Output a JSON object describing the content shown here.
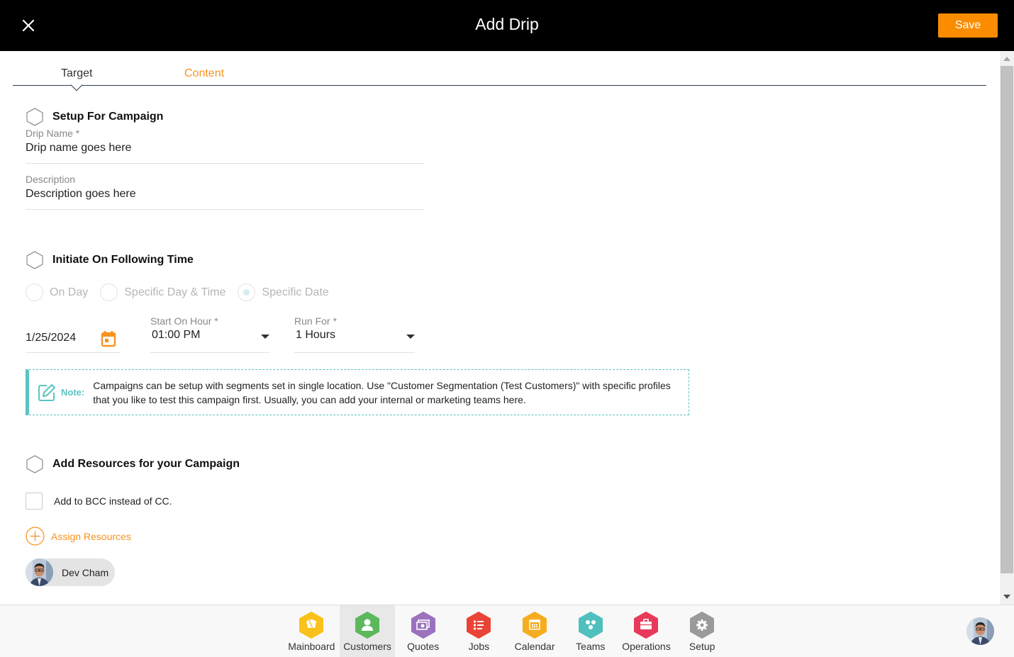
{
  "header": {
    "title": "Add Drip",
    "save_label": "Save",
    "close_icon": "close-icon"
  },
  "tabs": [
    {
      "label": "Target",
      "active": true
    },
    {
      "label": "Content",
      "active": false
    }
  ],
  "sections": {
    "setup": {
      "title": "Setup For Campaign",
      "drip_name": {
        "label": "Drip Name *",
        "value": "Drip name goes here"
      },
      "description": {
        "label": "Description",
        "value": "Description goes here"
      }
    },
    "initiate": {
      "title": "Initiate On Following Time",
      "radios": [
        {
          "label": "On Day",
          "checked": false
        },
        {
          "label": "Specific Day & Time",
          "checked": false
        },
        {
          "label": "Specific Date",
          "checked": true
        }
      ],
      "date": {
        "value": "1/25/2024",
        "icon": "calendar-icon"
      },
      "start_on_hour": {
        "label": "Start On Hour *",
        "value": "01:00 PM"
      },
      "run_for": {
        "label": "Run For *",
        "value": "1 Hours"
      },
      "note": {
        "label": "Note:",
        "text": "Campaigns can be setup with segments set in single location. Use \"Customer Segmentation (Test Customers)\" with specific profiles that you like to test this campaign first. Usually, you can add your internal or marketing teams here."
      }
    },
    "resources": {
      "title": "Add Resources for your Campaign",
      "bcc_checkbox": {
        "label": "Add to BCC instead of CC.",
        "checked": false
      },
      "assign_label": "Assign Resources",
      "assigned": [
        {
          "name": "Dev Cham"
        }
      ]
    }
  },
  "bottom_nav": {
    "items": [
      {
        "label": "Mainboard",
        "color": "#f9c21a",
        "icon": "mainboard-icon",
        "active": false
      },
      {
        "label": "Customers",
        "color": "#5cb85c",
        "icon": "customers-icon",
        "active": true
      },
      {
        "label": "Quotes",
        "color": "#9b72bd",
        "icon": "quotes-icon",
        "active": false
      },
      {
        "label": "Jobs",
        "color": "#e94437",
        "icon": "jobs-icon",
        "active": false
      },
      {
        "label": "Calendar",
        "color": "#f6ad1f",
        "icon": "calendar-icon",
        "active": false
      },
      {
        "label": "Teams",
        "color": "#4fc0bd",
        "icon": "teams-icon",
        "active": false
      },
      {
        "label": "Operations",
        "color": "#e8395a",
        "icon": "operations-icon",
        "active": false
      },
      {
        "label": "Setup",
        "color": "#9a9a9a",
        "icon": "setup-icon",
        "active": false
      }
    ]
  },
  "colors": {
    "accent": "#fb8c00",
    "tab_content": "#f7931e",
    "note": "#5bc4c1"
  }
}
